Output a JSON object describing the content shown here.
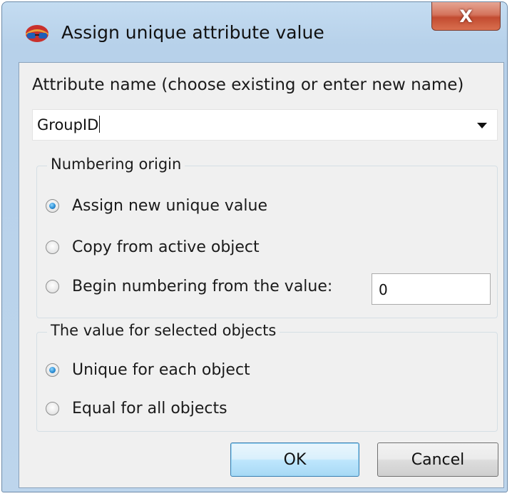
{
  "window": {
    "title": "Assign unique attribute value",
    "close_glyph": "X",
    "icon": "app-logo-icon"
  },
  "attribute": {
    "label": "Attribute name (choose existing or enter new name)",
    "value": "GroupID"
  },
  "numbering_origin": {
    "title": "Numbering origin",
    "options": [
      {
        "label": "Assign new unique value",
        "checked": true
      },
      {
        "label": "Copy from active object",
        "checked": false
      },
      {
        "label": "Begin numbering from the value:",
        "checked": false
      }
    ],
    "start_value": "0"
  },
  "selected_objects": {
    "title": "The value for selected objects",
    "options": [
      {
        "label": "Unique for each object",
        "checked": true
      },
      {
        "label": "Equal for all objects",
        "checked": false
      }
    ]
  },
  "buttons": {
    "ok": "OK",
    "cancel": "Cancel"
  }
}
